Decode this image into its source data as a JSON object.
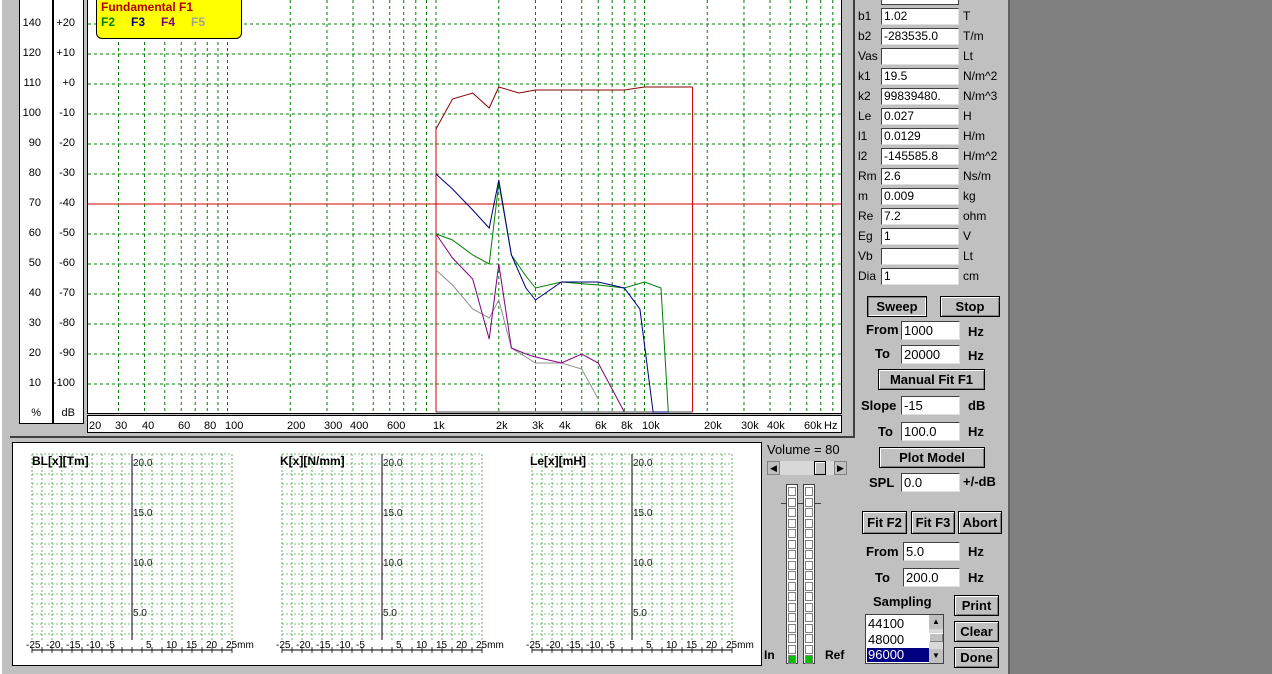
{
  "main_chart": {
    "y_axis_percent": [
      "140",
      "120",
      "110",
      "100",
      "90",
      "80",
      "70",
      "60",
      "50",
      "40",
      "30",
      "20",
      "10"
    ],
    "y_axis_db": [
      "+20",
      "+10",
      "+0",
      "-10",
      "-20",
      "-30",
      "-40",
      "-50",
      "-60",
      "-70",
      "-80",
      "-90",
      "-100"
    ],
    "y_unit_percent": "%",
    "y_unit_db": "dB",
    "x_ticks": [
      "20",
      "30",
      "40",
      "60",
      "80",
      "100",
      "200",
      "300",
      "400",
      "600",
      "1k",
      "2k",
      "3k",
      "4k",
      "6k",
      "8k",
      "10k",
      "20k",
      "30k",
      "40k",
      "60k",
      "Hz"
    ],
    "legend": {
      "title": "Fundamental F1",
      "f2": "F2",
      "f3": "F3",
      "f4": "F4",
      "f5": "F5"
    },
    "colors": {
      "f1": "#8b0000",
      "f2": "#008000",
      "f3": "#000080",
      "f4": "#800080",
      "f5": "#909090",
      "grid": "#008000",
      "ref_line": "#d00000"
    }
  },
  "chart_data": [
    {
      "type": "line",
      "title": "Fundamental F1",
      "x_scale": "log",
      "xlim": [
        20,
        100000
      ],
      "ylim_db": [
        -110,
        30
      ],
      "reference_line_db": -40,
      "series": [
        {
          "name": "Fundamental F1",
          "x": [
            1000,
            1200,
            1500,
            1800,
            2000,
            2500,
            3000,
            5000,
            8000,
            10000,
            15000,
            17000
          ],
          "y": [
            -15,
            -5,
            -3,
            -8,
            -1,
            -3,
            -2,
            -2,
            -2,
            -1,
            -1,
            -1
          ]
        },
        {
          "name": "F2",
          "x": [
            1000,
            1200,
            1500,
            1800,
            2000,
            2300,
            2700,
            3000,
            4000,
            6000,
            8000,
            10000,
            12000,
            13000
          ],
          "y": [
            -50,
            -52,
            -57,
            -60,
            -33,
            -57,
            -64,
            -68,
            -66,
            -67,
            -68,
            -66,
            -68,
            -110
          ]
        },
        {
          "name": "F3",
          "x": [
            1000,
            1200,
            1500,
            1800,
            2000,
            2300,
            2700,
            3000,
            4000,
            6000,
            8000,
            9500,
            11000,
            13000
          ],
          "y": [
            -30,
            -35,
            -42,
            -48,
            -32,
            -57,
            -68,
            -72,
            -66,
            -66,
            -68,
            -75,
            -110,
            -110
          ]
        },
        {
          "name": "F4",
          "x": [
            1000,
            1200,
            1500,
            1800,
            2000,
            2300,
            2700,
            3000,
            4000,
            5000,
            6000,
            8000
          ],
          "y": [
            -50,
            -58,
            -65,
            -85,
            -60,
            -88,
            -90,
            -91,
            -93,
            -90,
            -93,
            -110
          ]
        },
        {
          "name": "F5",
          "x": [
            1000,
            1200,
            1500,
            1800,
            2000,
            2300,
            2700,
            3000,
            4000,
            5000,
            6000
          ],
          "y": [
            -62,
            -67,
            -75,
            -78,
            -72,
            -88,
            -91,
            -93,
            -93,
            -95,
            -105
          ]
        }
      ]
    },
    {
      "type": "line",
      "title": "BL[x][Tm]",
      "ylim": [
        0,
        20
      ],
      "xlim": [
        -25,
        25
      ],
      "y_ticks": [
        "20.0",
        "15.0",
        "10.0",
        "5.0"
      ],
      "x_ticks": [
        "-25",
        "-20",
        "-15",
        "-10",
        "-5",
        "5",
        "10",
        "15",
        "20",
        "25mm"
      ],
      "series": []
    },
    {
      "type": "line",
      "title": "K[x][N/mm]",
      "ylim": [
        0,
        20
      ],
      "xlim": [
        -25,
        25
      ],
      "y_ticks": [
        "20.0",
        "15.0",
        "10.0",
        "5.0"
      ],
      "x_ticks": [
        "-25",
        "-20",
        "-15",
        "-10",
        "-5",
        "5",
        "10",
        "15",
        "20",
        "25mm"
      ],
      "series": []
    },
    {
      "type": "line",
      "title": "Le[x][mH]",
      "ylim": [
        0,
        20
      ],
      "xlim": [
        -25,
        25
      ],
      "y_ticks": [
        "20.0",
        "15.0",
        "10.0",
        "5.0"
      ],
      "x_ticks": [
        "-25",
        "-20",
        "-15",
        "-10",
        "-5",
        "5",
        "10",
        "15",
        "20",
        "25mm"
      ],
      "series": []
    }
  ],
  "mini_charts": [
    {
      "title": "BL[x][Tm]"
    },
    {
      "title": "K[x][N/mm]"
    },
    {
      "title": "Le[x][mH]"
    }
  ],
  "mini_y_ticks": [
    "20.0",
    "15.0",
    "10.0",
    "5.0"
  ],
  "mini_x_ticks": [
    "-25",
    "-20",
    "-15",
    "-10",
    "-5",
    "5",
    "10",
    "15",
    "20",
    "25mm"
  ],
  "params": [
    {
      "label": "b1",
      "value": "1.02",
      "unit": "T"
    },
    {
      "label": "b2",
      "value": "-283535.0",
      "unit": "T/m"
    },
    {
      "label": "Vas",
      "value": "",
      "unit": "Lt"
    },
    {
      "label": "k1",
      "value": "19.5",
      "unit": "N/m^2"
    },
    {
      "label": "k2",
      "value": "99839480.",
      "unit": "N/m^3"
    },
    {
      "label": "Le",
      "value": "0.027",
      "unit": "H"
    },
    {
      "label": "l1",
      "value": "0.0129",
      "unit": "H/m"
    },
    {
      "label": "l2",
      "value": "-145585.8",
      "unit": "H/m^2"
    },
    {
      "label": "Rm",
      "value": "2.6",
      "unit": "Ns/m"
    },
    {
      "label": "m",
      "value": "0.009",
      "unit": "kg"
    },
    {
      "label": "Re",
      "value": "7.2",
      "unit": "ohm"
    },
    {
      "label": "Eg",
      "value": "1",
      "unit": "V"
    },
    {
      "label": "Vb",
      "value": "",
      "unit": "Lt"
    },
    {
      "label": "Dia",
      "value": "1",
      "unit": "cm"
    }
  ],
  "controls": {
    "sweep": "Sweep",
    "stop": "Stop",
    "from_label": "From",
    "from_value": "1000",
    "to_label": "To",
    "to_value": "20000",
    "hz": "Hz",
    "manual_fit": "Manual Fit F1",
    "slope_label": "Slope",
    "slope_value": "-15",
    "db": "dB",
    "slope_to_value": "100.0",
    "plot_model": "Plot Model",
    "spl_label": "SPL",
    "spl_value": "0.0",
    "spl_unit": "+/-dB",
    "fit_f2": "Fit F2",
    "fit_f3": "Fit F3",
    "abort": "Abort",
    "fit_from_value": "5.0",
    "fit_to_value": "200.0",
    "sampling_label": "Sampling",
    "sampling_options": [
      "44100",
      "48000",
      "96000"
    ],
    "print": "Print",
    "clear": "Clear",
    "done": "Done"
  },
  "volume": {
    "label": "Volume = 80",
    "level": 80,
    "in_label": "In",
    "ref_label": "Ref"
  }
}
